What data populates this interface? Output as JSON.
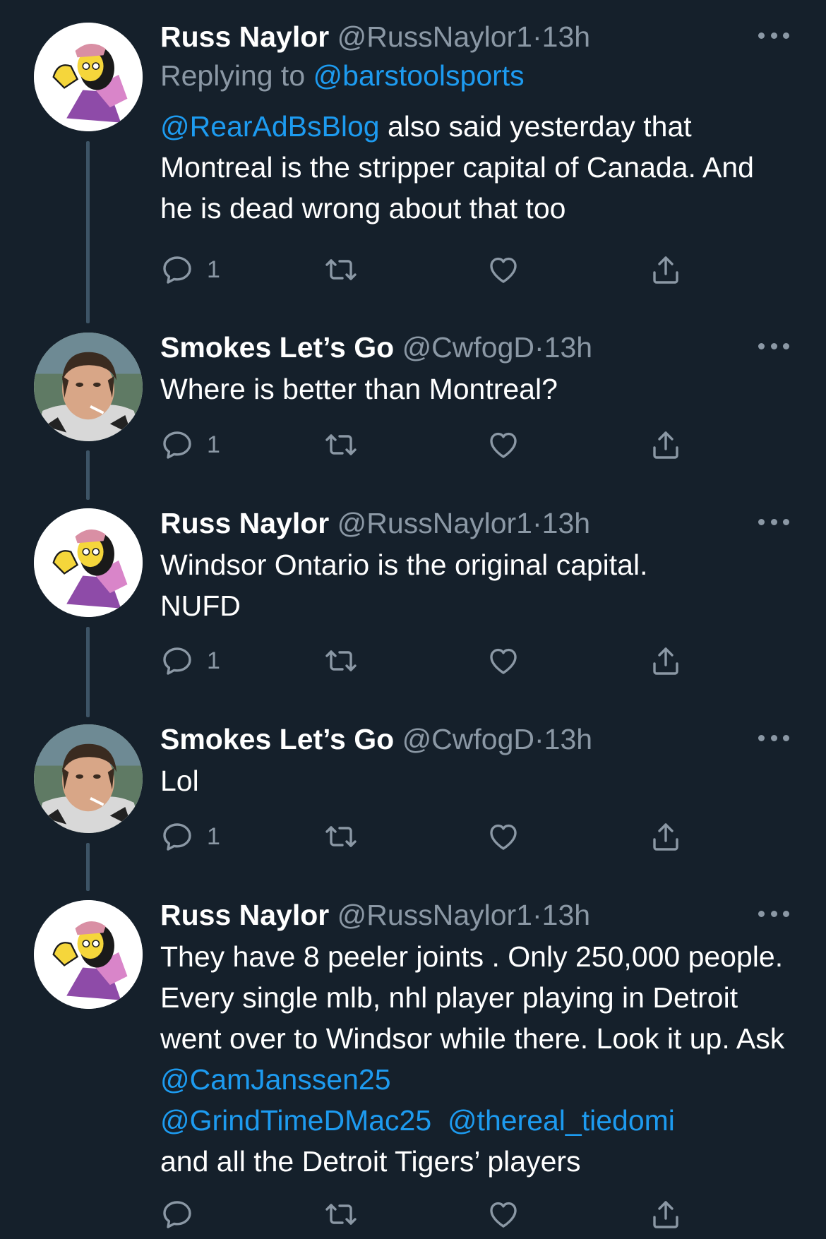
{
  "colors": {
    "background": "#15202b",
    "link": "#1d9bf0",
    "muted": "#8b98a5",
    "thread_line": "#3d5466"
  },
  "icons": {
    "reply": "speech-bubble-icon",
    "retweet": "retweet-icon",
    "like": "heart-icon",
    "share": "share-icon",
    "more": "more-dots-icon"
  },
  "tweets": [
    {
      "name": "Russ Naylor",
      "handle": "@RussNaylor1",
      "dot": "·",
      "time": "13h",
      "replying_prefix": "Replying to",
      "replying_to": "@barstoolsports",
      "mention": "@RearAdBsBlog",
      "text": " also said yesterday that Montreal is the stripper capital of Canada. And he is dead wrong about that too",
      "reply_count": "1",
      "avatar": "cartoon-avatar"
    },
    {
      "name": "Smokes Let’s Go",
      "handle": "@CwfogD",
      "dot": "·",
      "time": "13h",
      "text": "Where is better than Montreal?",
      "reply_count": "1",
      "avatar": "photo-avatar"
    },
    {
      "name": "Russ Naylor",
      "handle": "@RussNaylor1",
      "dot": "·",
      "time": "13h",
      "text": "Windsor Ontario is the original capital. NUFD",
      "reply_count": "1",
      "avatar": "cartoon-avatar"
    },
    {
      "name": "Smokes Let’s Go",
      "handle": "@CwfogD",
      "dot": "·",
      "time": "13h",
      "text": "Lol",
      "reply_count": "1",
      "avatar": "photo-avatar"
    },
    {
      "name": "Russ Naylor",
      "handle": "@RussNaylor1",
      "dot": "·",
      "time": "13h",
      "text_before": "They have 8 peeler joints . Only 250,000 people. Every single mlb, nhl player playing in Detroit went over to Windsor while there. Look it up. Ask ",
      "mention_1": "@CamJanssen25",
      "mention_2": "@GrindTimeDMac25",
      "mention_3": "@thereal_tiedomi",
      "text_after": "and all the Detroit Tigers’ players",
      "reply_count": "",
      "avatar": "cartoon-avatar"
    }
  ]
}
